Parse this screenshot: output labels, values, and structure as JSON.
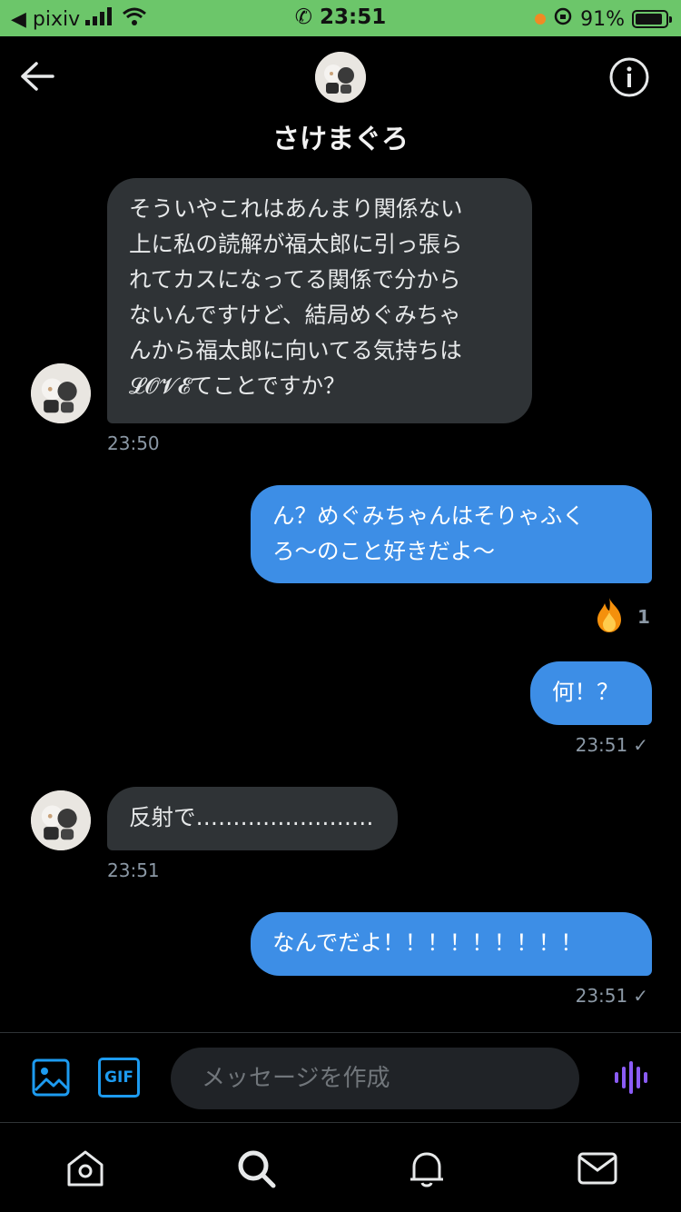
{
  "status_bar": {
    "carrier": "◀ pixiv",
    "time": "23:51",
    "battery": "91%"
  },
  "header": {
    "contact_name": "さけまぐろ"
  },
  "messages": [
    {
      "direction": "incoming",
      "lines": [
        "そういやこれはあんまり関係ない",
        "上に私の読解が福太郎に引っ張ら",
        "れてカスになってる関係で分から",
        "ないんですけど、結局めぐみちゃ",
        "んから福太郎に向いてる気持ちは",
        "𝓛𝓞𝓥𝓔てことですか？"
      ],
      "timestamp": "23:50"
    },
    {
      "direction": "outgoing",
      "lines": [
        "ん？めぐみちゃんはそりゃふく",
        "ろ〜のこと好きだよ〜"
      ],
      "reaction": {
        "emoji": "🔥",
        "count": "1"
      }
    },
    {
      "direction": "outgoing",
      "lines": [
        "何！？"
      ],
      "timestamp": "23:51"
    },
    {
      "direction": "incoming",
      "lines": [
        "反射で……………………"
      ],
      "timestamp": "23:51"
    },
    {
      "direction": "outgoing",
      "lines": [
        "なんでだよ！！！！！！！！！"
      ],
      "timestamp": "23:51"
    }
  ],
  "composer": {
    "placeholder": "メッセージを作成",
    "gif_label": "GIF"
  },
  "colors": {
    "status_bar": "#6cc66a",
    "outgoing_bubble": "#3d8ee6",
    "incoming_bubble": "#2f3336",
    "accent_blue": "#1d9bf0",
    "voice_purple": "#8b5cf6"
  },
  "icons": [
    "back-arrow-icon",
    "info-icon",
    "image-icon",
    "gif-icon",
    "voice-icon",
    "home-icon",
    "search-icon",
    "bell-icon",
    "mail-icon",
    "fire-icon",
    "check-icon"
  ]
}
